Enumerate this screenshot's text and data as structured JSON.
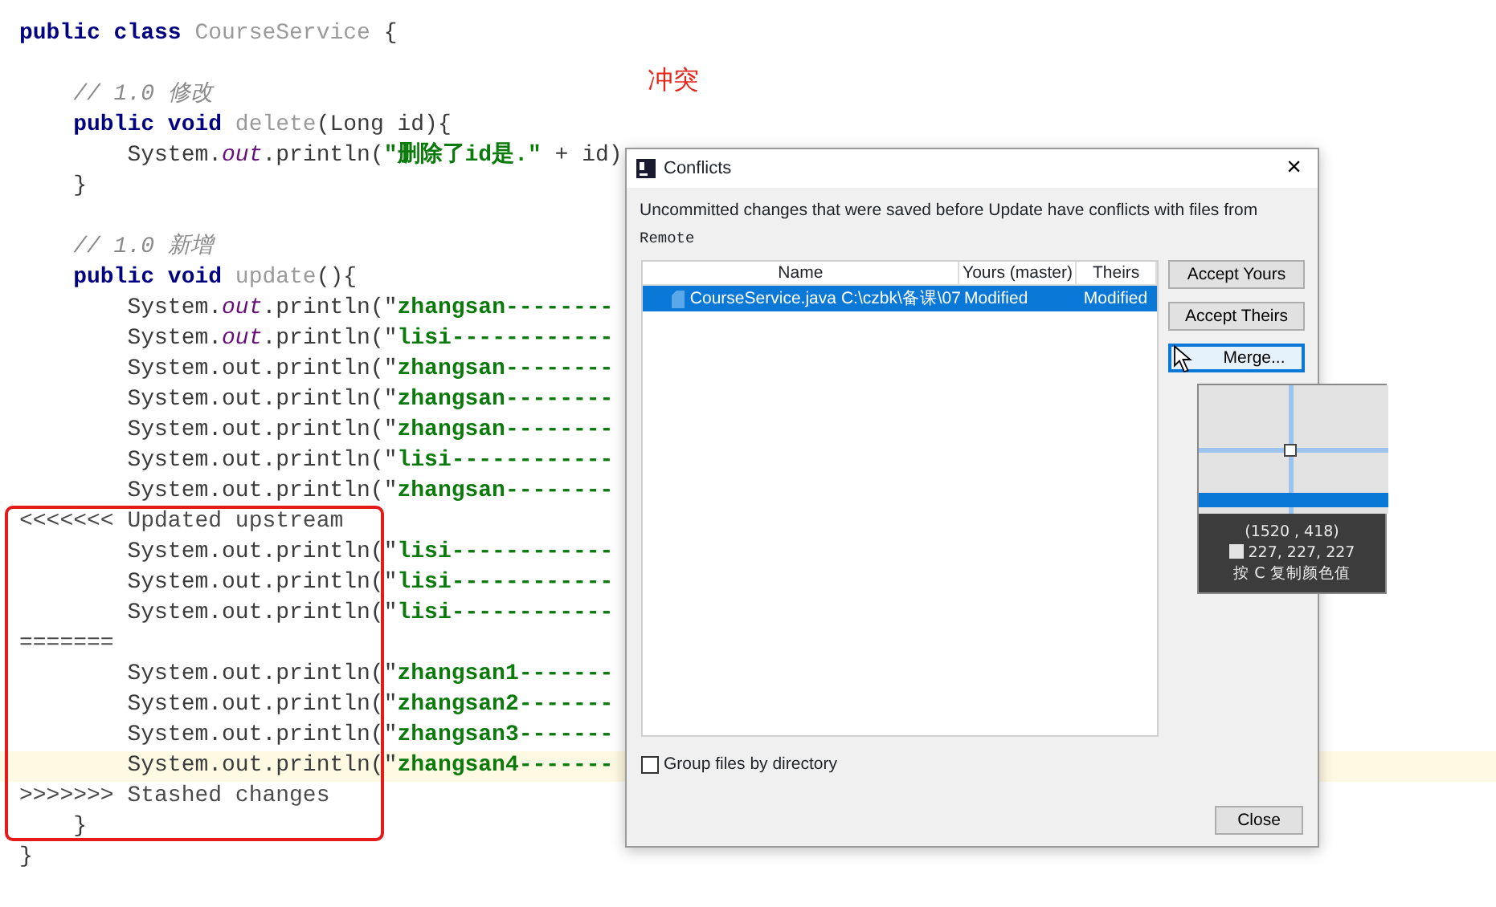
{
  "editor": {
    "lines": [
      {
        "kind": "code",
        "segments": [
          {
            "kind": "kw",
            "text": "public class "
          },
          {
            "kind": "name",
            "text": "CourseService"
          },
          {
            "kind": "plain",
            "text": " {"
          }
        ]
      },
      {
        "kind": "blank"
      },
      {
        "kind": "code",
        "segments": [
          {
            "kind": "comment",
            "text": "    // 1.0 修改"
          }
        ]
      },
      {
        "kind": "code",
        "segments": [
          {
            "kind": "kw",
            "text": "    public void "
          },
          {
            "kind": "name",
            "text": "delete"
          },
          {
            "kind": "plain",
            "text": "(Long id){"
          }
        ]
      },
      {
        "kind": "code",
        "segments": [
          {
            "kind": "plain",
            "text": "        System."
          },
          {
            "kind": "field",
            "text": "out"
          },
          {
            "kind": "plain",
            "text": ".println("
          },
          {
            "kind": "str",
            "text": "\"删除了id是.\""
          },
          {
            "kind": "plain",
            "text": " + id)"
          }
        ]
      },
      {
        "kind": "code",
        "segments": [
          {
            "kind": "plain",
            "text": "    }"
          }
        ]
      },
      {
        "kind": "blank"
      },
      {
        "kind": "code",
        "segments": [
          {
            "kind": "comment",
            "text": "    // 1.0 新增"
          }
        ]
      },
      {
        "kind": "code",
        "segments": [
          {
            "kind": "kw",
            "text": "    public void "
          },
          {
            "kind": "name",
            "text": "update"
          },
          {
            "kind": "plain",
            "text": "(){"
          }
        ]
      },
      {
        "kind": "code",
        "segments": [
          {
            "kind": "plain",
            "text": "        System."
          },
          {
            "kind": "field",
            "text": "out"
          },
          {
            "kind": "plain",
            "text": ".println(\""
          },
          {
            "kind": "str",
            "text": "zhangsan--------"
          }
        ]
      },
      {
        "kind": "code",
        "segments": [
          {
            "kind": "plain",
            "text": "        System."
          },
          {
            "kind": "field",
            "text": "out"
          },
          {
            "kind": "plain",
            "text": ".println(\""
          },
          {
            "kind": "str",
            "text": "lisi------------"
          }
        ]
      },
      {
        "kind": "code",
        "segments": [
          {
            "kind": "plain",
            "text": "        System.out.println(\""
          },
          {
            "kind": "str",
            "text": "zhangsan--------"
          }
        ]
      },
      {
        "kind": "code",
        "segments": [
          {
            "kind": "plain",
            "text": "        System.out.println(\""
          },
          {
            "kind": "str",
            "text": "zhangsan--------"
          }
        ]
      },
      {
        "kind": "code",
        "segments": [
          {
            "kind": "plain",
            "text": "        System.out.println(\""
          },
          {
            "kind": "str",
            "text": "zhangsan--------"
          }
        ]
      },
      {
        "kind": "code",
        "segments": [
          {
            "kind": "plain",
            "text": "        System.out.println(\""
          },
          {
            "kind": "str",
            "text": "lisi------------"
          }
        ]
      },
      {
        "kind": "code",
        "segments": [
          {
            "kind": "plain",
            "text": "        System.out.println(\""
          },
          {
            "kind": "str",
            "text": "zhangsan--------"
          }
        ]
      },
      {
        "kind": "code",
        "segments": [
          {
            "kind": "marker",
            "text": "<<<<<<< Updated upstream"
          }
        ]
      },
      {
        "kind": "code",
        "segments": [
          {
            "kind": "plain",
            "text": "        System.out.println(\""
          },
          {
            "kind": "str",
            "text": "lisi------------"
          }
        ]
      },
      {
        "kind": "code",
        "segments": [
          {
            "kind": "plain",
            "text": "        System.out.println(\""
          },
          {
            "kind": "str",
            "text": "lisi------------"
          }
        ]
      },
      {
        "kind": "code",
        "segments": [
          {
            "kind": "plain",
            "text": "        System.out.println(\""
          },
          {
            "kind": "str",
            "text": "lisi------------"
          }
        ]
      },
      {
        "kind": "code",
        "segments": [
          {
            "kind": "marker",
            "text": "======="
          }
        ]
      },
      {
        "kind": "code",
        "segments": [
          {
            "kind": "plain",
            "text": "        System.out.println(\""
          },
          {
            "kind": "str",
            "text": "zhangsan1-------"
          }
        ]
      },
      {
        "kind": "code",
        "segments": [
          {
            "kind": "plain",
            "text": "        System.out.println(\""
          },
          {
            "kind": "str",
            "text": "zhangsan2-------"
          }
        ]
      },
      {
        "kind": "code",
        "segments": [
          {
            "kind": "plain",
            "text": "        System.out.println(\""
          },
          {
            "kind": "str",
            "text": "zhangsan3-------"
          }
        ]
      },
      {
        "kind": "code",
        "current": true,
        "segments": [
          {
            "kind": "plain",
            "text": "        System.out.println(\""
          },
          {
            "kind": "str",
            "text": "zhangsan4-------"
          }
        ]
      },
      {
        "kind": "code",
        "segments": [
          {
            "kind": "marker",
            "text": ">>>>>>> Stashed changes"
          }
        ]
      },
      {
        "kind": "code",
        "segments": [
          {
            "kind": "plain",
            "text": "    }"
          }
        ]
      },
      {
        "kind": "code",
        "segments": [
          {
            "kind": "plain",
            "text": "}"
          }
        ]
      }
    ]
  },
  "annotation": {
    "text": "冲突"
  },
  "dialog": {
    "title": "Conflicts",
    "close": "×",
    "message": "Uncommitted changes that were saved before Update have conflicts with files from",
    "source": "Remote",
    "table": {
      "columns": [
        "Name",
        "Yours (master)",
        "Theirs"
      ],
      "rows": [
        {
          "file": "CourseService.java",
          "path": "C:\\czbk\\备课\\07",
          "yours": "Modified",
          "theirs": "Modified",
          "selected": true
        }
      ]
    },
    "buttons": [
      {
        "label": "Accept Yours",
        "focused": false
      },
      {
        "label": "Accept Theirs",
        "focused": false
      },
      {
        "label": "Merge...",
        "focused": true
      }
    ],
    "group_checkbox": {
      "label": "Group files by directory",
      "checked": false
    },
    "close_button": {
      "label": "Close"
    }
  },
  "color_picker": {
    "coords": "(1520 , 418)",
    "rgb": "227, 227, 227",
    "hint": "按 C 复制颜色值"
  }
}
